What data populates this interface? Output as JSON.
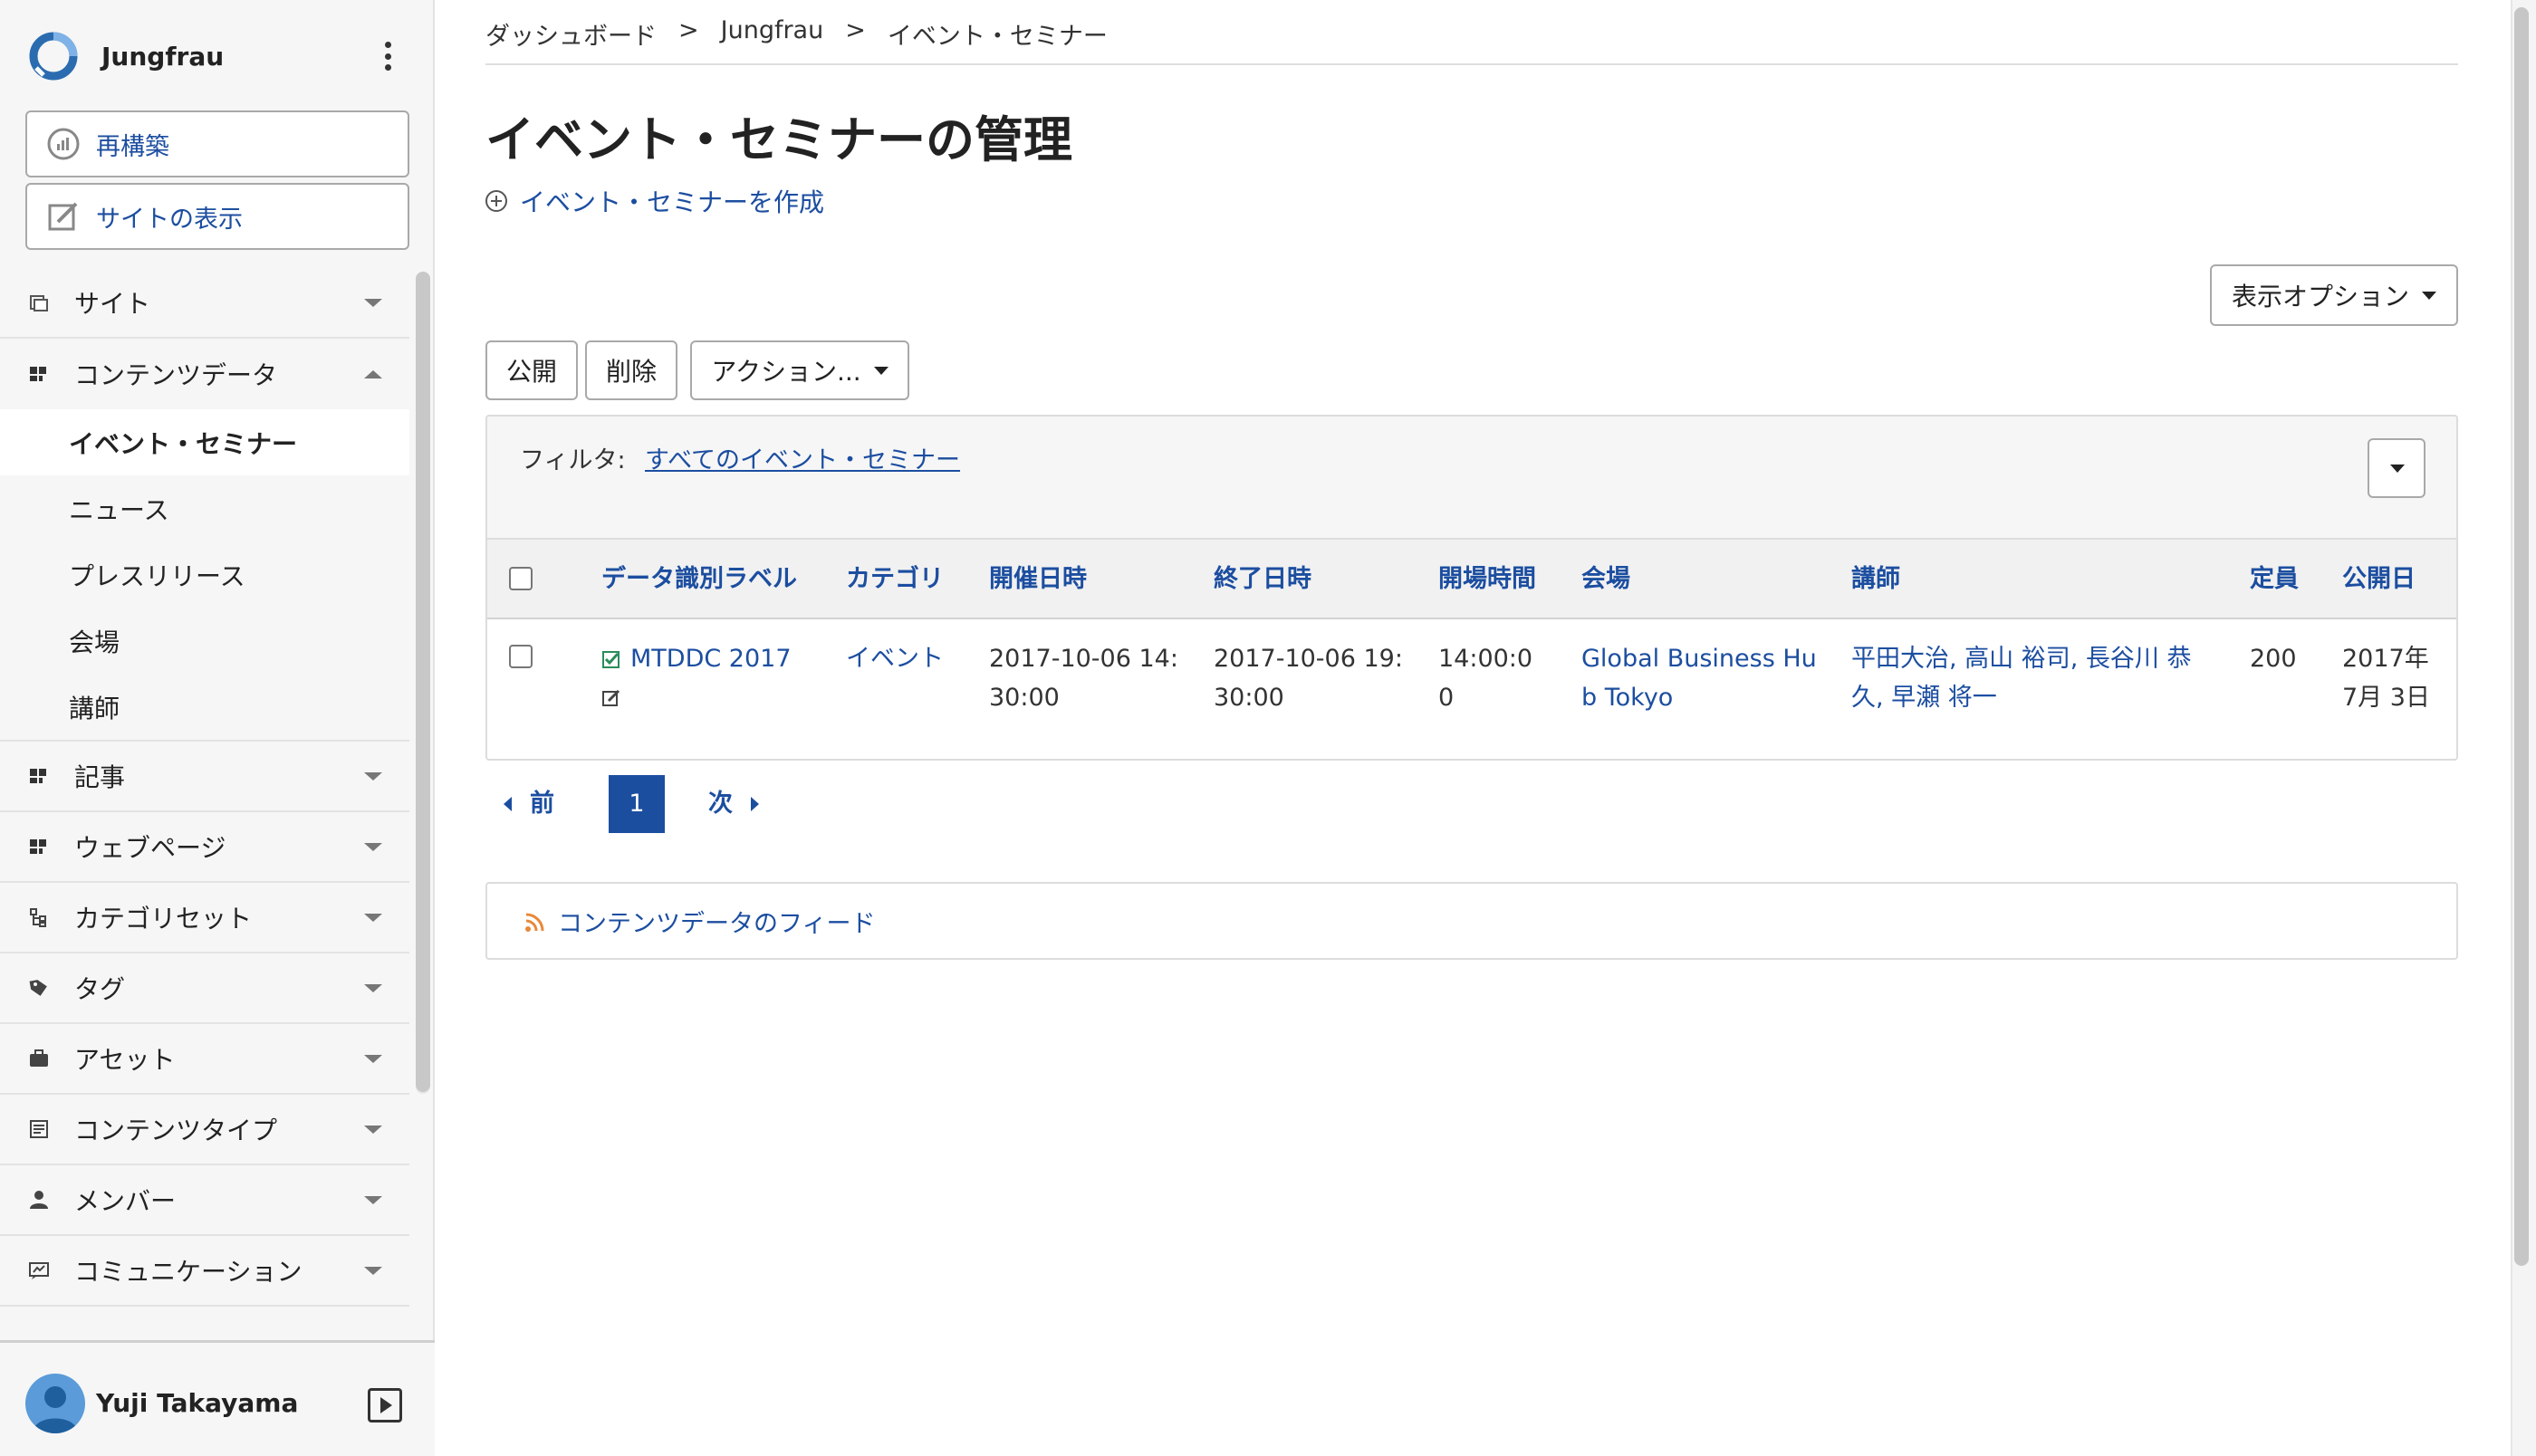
{
  "app": {
    "name": "Jungfrau"
  },
  "sidebar": {
    "rebuild_label": "再構築",
    "view_site_label": "サイトの表示",
    "groups": [
      {
        "label": "サイト",
        "icon": "site-icon"
      },
      {
        "label": "コンテンツデータ",
        "icon": "content-data-icon",
        "expanded": true
      },
      {
        "label": "記事",
        "icon": "entries-icon"
      },
      {
        "label": "ウェブページ",
        "icon": "webpages-icon"
      },
      {
        "label": "カテゴリセット",
        "icon": "category-set-icon"
      },
      {
        "label": "タグ",
        "icon": "tag-icon"
      },
      {
        "label": "アセット",
        "icon": "assets-icon"
      },
      {
        "label": "コンテンツタイプ",
        "icon": "content-type-icon"
      },
      {
        "label": "メンバー",
        "icon": "member-icon"
      },
      {
        "label": "コミュニケーション",
        "icon": "communication-icon"
      }
    ],
    "content_data_items": [
      {
        "label": "イベント・セミナー",
        "active": true
      },
      {
        "label": "ニュース"
      },
      {
        "label": "プレスリリース"
      },
      {
        "label": "会場"
      },
      {
        "label": "講師"
      }
    ]
  },
  "user": {
    "name": "Yuji Takayama"
  },
  "breadcrumb": [
    "ダッシュボード",
    ">",
    "Jungfrau",
    ">",
    "イベント・セミナー"
  ],
  "page": {
    "title": "イベント・セミナーの管理",
    "create_label": "イベント・セミナーを作成",
    "display_options_label": "表示オプション",
    "publish_label": "公開",
    "delete_label": "削除",
    "actions_label": "アクション..."
  },
  "filter": {
    "label": "フィルタ:",
    "value": "すべてのイベント・セミナー"
  },
  "table": {
    "columns": [
      "データ識別ラベル",
      "カテゴリ",
      "開催日時",
      "終了日時",
      "開場時間",
      "会場",
      "講師",
      "定員",
      "公開日"
    ],
    "rows": [
      {
        "label": "MTDDC 2017",
        "category": "イベント",
        "start_line1": "2017-10-06 14:",
        "start_line2": "30:00",
        "end_line1": "2017-10-06 19:",
        "end_line2": "30:00",
        "open_line1": "14:00:0",
        "open_line2": "0",
        "venue_line1": "Global Business Hu",
        "venue_line2": "b Tokyo",
        "speakers_line1": "平田大治, 高山 裕司, 長谷川 恭",
        "speakers_line2": "久, 早瀬 将一",
        "capacity": "200",
        "published_line1": "2017年",
        "published_line2": "7月 3日"
      }
    ]
  },
  "pagination": {
    "prev": "前",
    "current": "1",
    "next": "次"
  },
  "feed": {
    "label": "コンテンツデータのフィード"
  },
  "colors": {
    "link": "#1c4ea0",
    "feed": "#e8893a",
    "published": "#2a8c5a"
  }
}
